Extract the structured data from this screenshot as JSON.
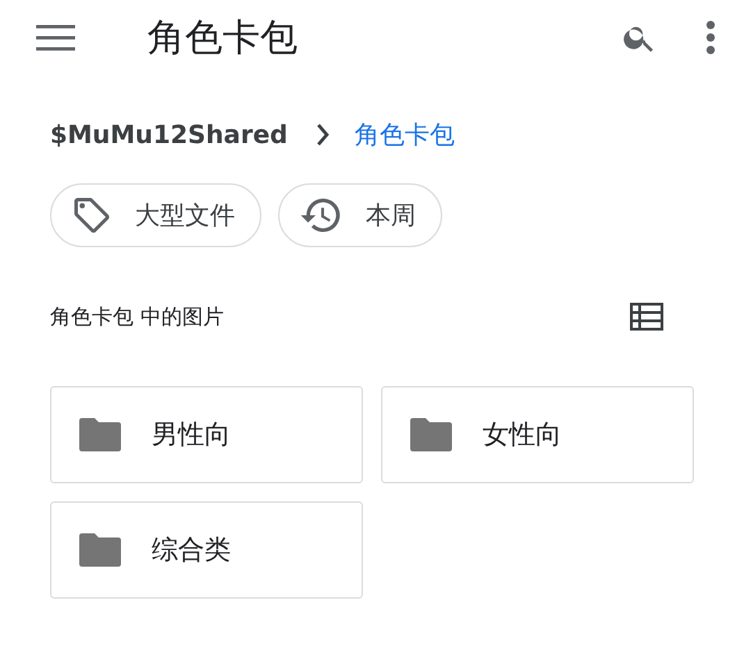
{
  "app_bar": {
    "title": "角色卡包"
  },
  "breadcrumb": [
    {
      "label": "$MuMu12Shared",
      "selected": false
    },
    {
      "label": "角色卡包",
      "selected": true
    }
  ],
  "filters": [
    {
      "label": "大型文件",
      "kind": "tag"
    },
    {
      "label": "本周",
      "kind": "history"
    }
  ],
  "section": {
    "title": "角色卡包 中的图片"
  },
  "folders": [
    {
      "name": "男性向"
    },
    {
      "name": "女性向"
    },
    {
      "name": "综合类"
    }
  ]
}
